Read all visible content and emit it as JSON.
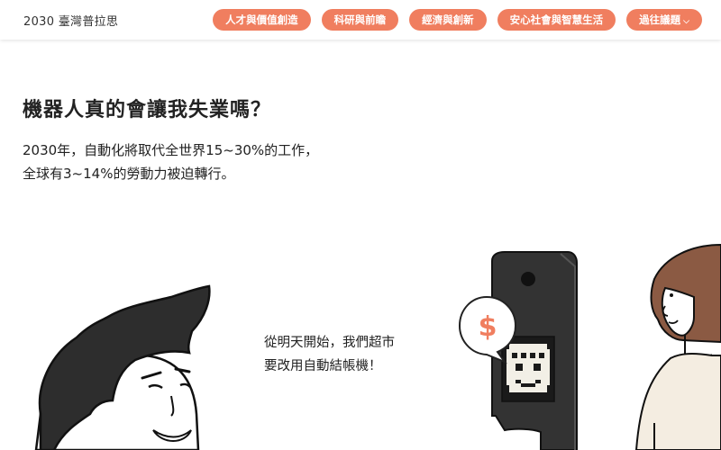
{
  "header": {
    "site_title": "2030 臺灣普拉思",
    "nav": [
      {
        "label": "人才與價值創造"
      },
      {
        "label": "科研與前瞻"
      },
      {
        "label": "經濟與創新"
      },
      {
        "label": "安心社會與智慧生活"
      },
      {
        "label": "過往議題"
      }
    ]
  },
  "main": {
    "title": "機器人真的會讓我失業嗎？",
    "intro_line1": "2030年，自動化將取代全世界15~30%的工作，",
    "intro_line2": "全球有3~14%的勞動力被迫轉行。",
    "speech_line1": "從明天開始，我們超市",
    "speech_line2": "要改用自動結帳機！",
    "dollar_sign": "$"
  },
  "colors": {
    "accent": "#f07e5f",
    "hair_dark": "#2d2d2d",
    "hair_brown": "#8b5a43",
    "machine": "#333333"
  }
}
